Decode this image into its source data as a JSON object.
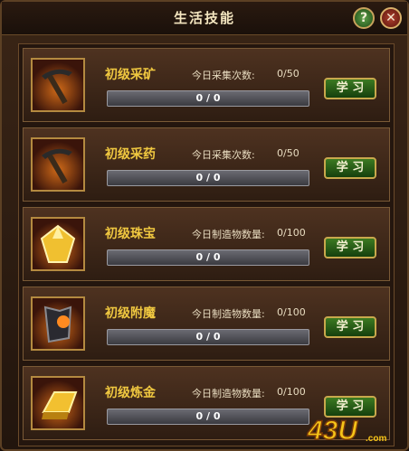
{
  "window": {
    "title": "生活技能",
    "help_label": "?",
    "close_label": "✕"
  },
  "skills": [
    {
      "name": "初级采矿",
      "count_label": "今日采集次数:",
      "count_value": "0/50",
      "progress_text": "0 / 0",
      "progress": 0,
      "button": "学 习",
      "icon": "pickaxe-icon"
    },
    {
      "name": "初级采药",
      "count_label": "今日采集次数:",
      "count_value": "0/50",
      "progress_text": "0 / 0",
      "progress": 0,
      "button": "学 习",
      "icon": "pickaxe-icon"
    },
    {
      "name": "初级珠宝",
      "count_label": "今日制造物数量:",
      "count_value": "0/100",
      "progress_text": "0 / 0",
      "progress": 0,
      "button": "学 习",
      "icon": "gem-icon"
    },
    {
      "name": "初级附魔",
      "count_label": "今日制造物数量:",
      "count_value": "0/100",
      "progress_text": "0 / 0",
      "progress": 0,
      "button": "学 习",
      "icon": "enchant-armor-icon"
    },
    {
      "name": "初级炼金",
      "count_label": "今日制造物数量:",
      "count_value": "0/100",
      "progress_text": "0 / 0",
      "progress": 0,
      "button": "学 习",
      "icon": "gold-bar-icon"
    }
  ],
  "watermark": {
    "text": "43U",
    "suffix": ".com"
  }
}
